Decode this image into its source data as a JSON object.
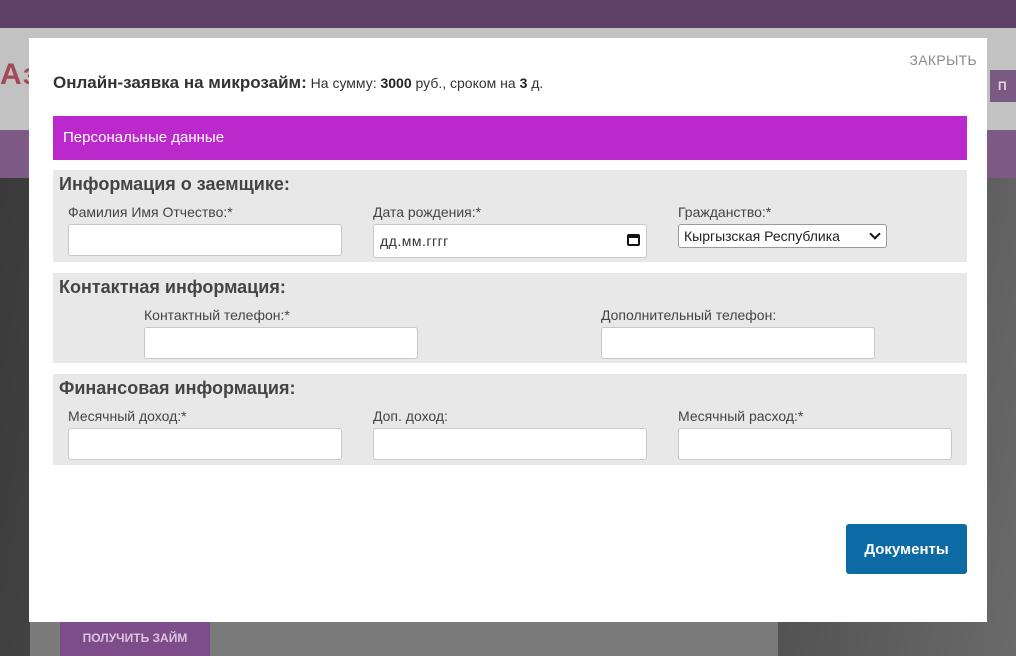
{
  "background": {
    "logo_text": "Аз",
    "nav_button_label": "П",
    "cta_label": "ПОЛУЧИТЬ ЗАЙМ"
  },
  "modal": {
    "close_label": "ЗАКРЫТЬ",
    "title": "Онлайн-заявка на микрозайм:",
    "summary_prefix": "На сумму:",
    "amount": "3000",
    "summary_mid": "руб., сроком на",
    "term": "3",
    "summary_suffix": "д.",
    "section_title": "Персональные данные",
    "borrower": {
      "title": "Информация о заемщике:",
      "full_name_label": "Фамилия Имя Отчество:*",
      "full_name_value": "",
      "birth_date_label": "Дата рождения:*",
      "birth_date_placeholder": "дд.мм.гггг",
      "citizenship_label": "Гражданство:*",
      "citizenship_selected": "Кыргызская Республика"
    },
    "contact": {
      "title": "Контактная информация:",
      "phone_label": "Контактный телефон:*",
      "phone_value": "",
      "extra_phone_label": "Дополнительный телефон:",
      "extra_phone_value": ""
    },
    "finance": {
      "title": "Финансовая информация:",
      "income_label": "Месячный доход:*",
      "income_value": "",
      "extra_income_label": "Доп. доход:",
      "extra_income_value": "",
      "expense_label": "Месячный расход:*",
      "expense_value": ""
    },
    "documents_button": "Документы"
  },
  "colors": {
    "section_bar": "#bb29cc",
    "primary_button": "#0c6aa4",
    "group_background": "#e8e8e8"
  }
}
